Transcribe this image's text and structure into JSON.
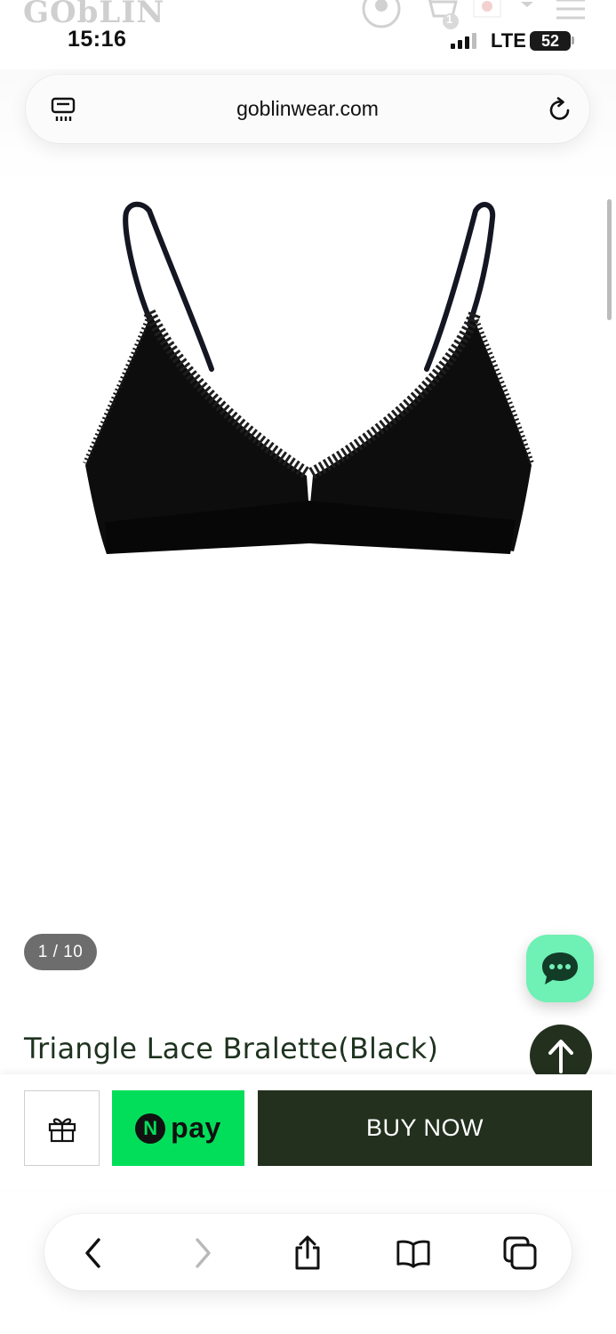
{
  "site_header": {
    "logo": "GObLIN",
    "cart_count": "1"
  },
  "status_bar": {
    "time": "15:16",
    "network": "LTE",
    "battery": "52"
  },
  "browser": {
    "url": "goblinwear.com"
  },
  "product": {
    "image_counter": "1 / 10",
    "title": "Triangle Lace Bralette(Black)"
  },
  "purchase_bar": {
    "npay_badge": "N",
    "npay_label": "pay",
    "buy_label": "BUY NOW"
  },
  "colors": {
    "brand_dark_green": "#23301e",
    "npay_green": "#03de5a",
    "chat_mint": "#6ff0b4",
    "title_text": "#1f3320"
  },
  "icons": {
    "reader": "reader-mode-icon",
    "reload": "reload-icon",
    "gift": "gift-icon",
    "chat": "chat-bubble-icon",
    "scroll_top": "arrow-up-icon",
    "back": "chevron-left-icon",
    "forward": "chevron-right-icon",
    "share": "share-icon",
    "bookmarks": "book-icon",
    "tabs": "tabs-icon"
  }
}
